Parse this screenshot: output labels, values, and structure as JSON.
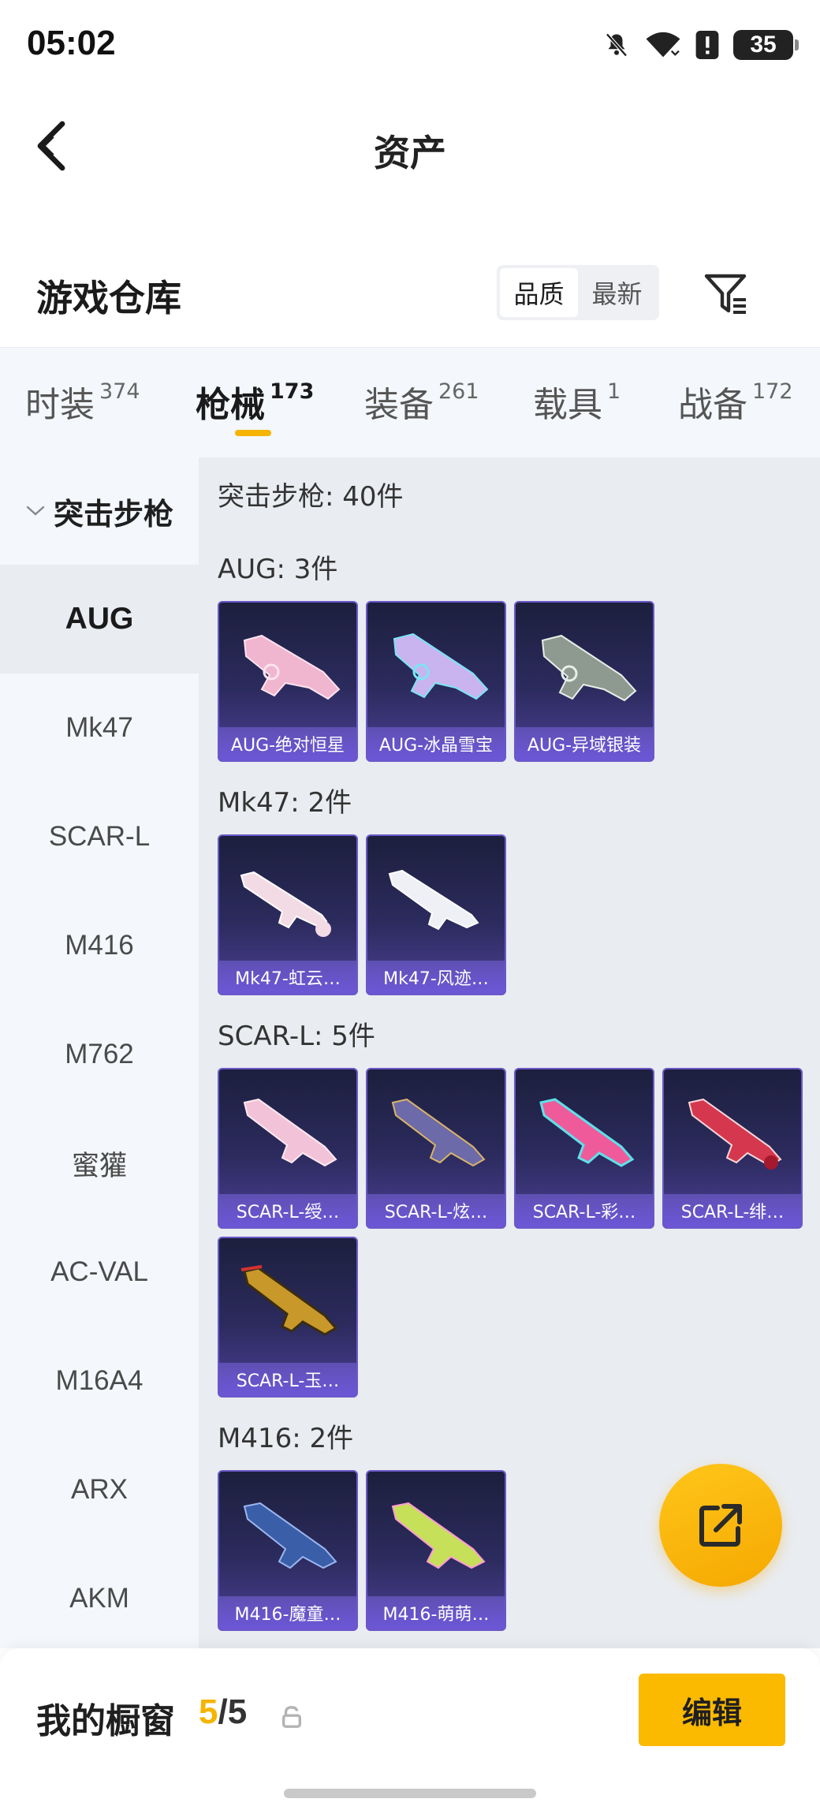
{
  "status": {
    "time": "05:02",
    "battery": "35"
  },
  "nav": {
    "title": "资产"
  },
  "warehouse": {
    "title": "游戏仓库",
    "sort_options": [
      "品质",
      "最新"
    ],
    "sort_selected": "品质"
  },
  "tabs": [
    {
      "label": "时装",
      "count": "374"
    },
    {
      "label": "枪械",
      "count": "173",
      "active": true
    },
    {
      "label": "装备",
      "count": "261"
    },
    {
      "label": "载具",
      "count": "1"
    },
    {
      "label": "战备",
      "count": "172"
    }
  ],
  "sidebar": {
    "group": "突击步枪",
    "items": [
      "AUG",
      "Mk47",
      "SCAR-L",
      "M416",
      "M762",
      "蜜獾",
      "AC-VAL",
      "M16A4",
      "ARX",
      "AKM"
    ],
    "selected": "AUG"
  },
  "main": {
    "total": "突击步枪: 40件",
    "sections": [
      {
        "label": "AUG: 3件",
        "items": [
          "AUG-绝对恒星",
          "AUG-冰晶雪宝",
          "AUG-异域银装"
        ]
      },
      {
        "label": "Mk47: 2件",
        "items": [
          "Mk47-虹云…",
          "Mk47-风迹…"
        ]
      },
      {
        "label": "SCAR-L: 5件",
        "items": [
          "SCAR-L-绶…",
          "SCAR-L-炫…",
          "SCAR-L-彩…",
          "SCAR-L-绯…",
          "SCAR-L-玉…"
        ]
      },
      {
        "label": "M416: 2件",
        "items": [
          "M416-魔童…",
          "M416-萌萌…"
        ]
      }
    ]
  },
  "bottom": {
    "title": "我的橱窗",
    "current": "5",
    "separator": "/",
    "max": "5",
    "edit_label": "编辑"
  },
  "colors": {
    "accent": "#f5b400",
    "card_border": "#6b58c9"
  }
}
